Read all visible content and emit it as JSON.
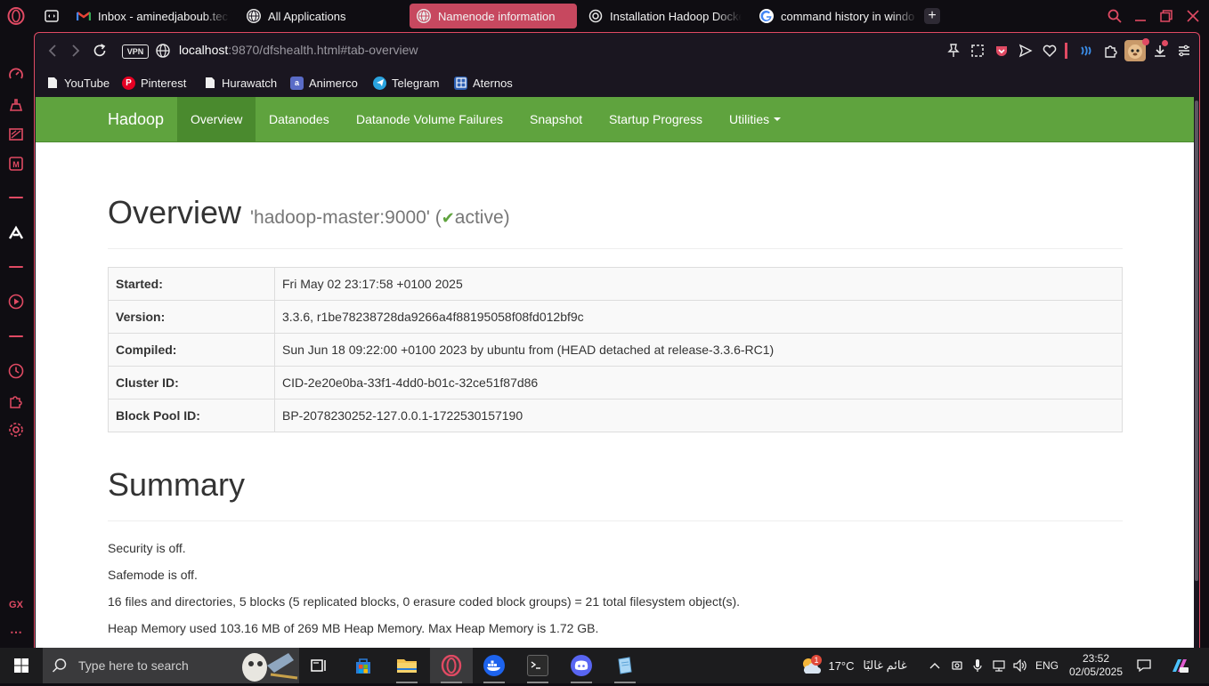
{
  "colors": {
    "accent": "#e04a63",
    "hadoop_green": "#5fa33e",
    "active_tab": "#c7485f"
  },
  "sidebar": {
    "gx_label": "GX",
    "more": "⋯"
  },
  "tabs": [
    {
      "title": "Inbox - aminedjaboub.tec",
      "icon": "gmail-icon"
    },
    {
      "title": "All Applications",
      "icon": "globe-icon"
    },
    {
      "title": "Namenode information",
      "icon": "globe-icon",
      "active": true
    },
    {
      "title": "Installation Hadoop Docke",
      "icon": "chatgpt-icon"
    },
    {
      "title": "command history in windo",
      "icon": "google-icon"
    }
  ],
  "address": {
    "vpn": "VPN",
    "host": "localhost",
    "path": ":9870/dfshealth.html#tab-overview"
  },
  "bookmarks": [
    "YouTube",
    "Pinterest",
    "Hurawatch",
    "Animerco",
    "Telegram",
    "Aternos"
  ],
  "hadoop": {
    "brand": "Hadoop",
    "nav": [
      "Overview",
      "Datanodes",
      "Datanode Volume Failures",
      "Snapshot",
      "Startup Progress",
      "Utilities"
    ],
    "overview_title": "Overview",
    "overview_host": "'hadoop-master:9000' (",
    "overview_state": "active",
    "overview_close": ")",
    "info_rows": [
      {
        "label": "Started:",
        "value": "Fri May 02 23:17:58 +0100 2025"
      },
      {
        "label": "Version:",
        "value": "3.3.6, r1be78238728da9266a4f88195058f08fd012bf9c"
      },
      {
        "label": "Compiled:",
        "value": "Sun Jun 18 09:22:00 +0100 2023 by ubuntu from (HEAD detached at release-3.3.6-RC1)"
      },
      {
        "label": "Cluster ID:",
        "value": "CID-2e20e0ba-33f1-4dd0-b01c-32ce51f87d86"
      },
      {
        "label": "Block Pool ID:",
        "value": "BP-2078230252-127.0.0.1-1722530157190"
      }
    ],
    "summary_title": "Summary",
    "summary_lines": [
      "Security is off.",
      "Safemode is off.",
      "16 files and directories, 5 blocks (5 replicated blocks, 0 erasure coded block groups) = 21 total filesystem object(s).",
      "Heap Memory used 103.16 MB of 269 MB Heap Memory. Max Heap Memory is 1.72 GB."
    ]
  },
  "taskbar": {
    "search_placeholder": "Type here to search",
    "weather_temp": "17°C",
    "weather_text": "غائم غالبًا",
    "weather_badge": "1",
    "lang": "ENG",
    "time": "23:52",
    "date": "02/05/2025"
  }
}
